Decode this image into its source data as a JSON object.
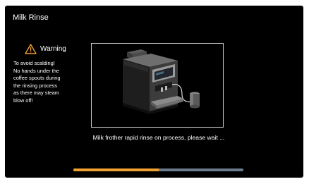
{
  "screen": {
    "title": "Milk Rinse"
  },
  "warning": {
    "label": "Warning",
    "icon": "warning-triangle-icon",
    "icon_color": "#f0a030",
    "lines": [
      "To avoid scalding!",
      "No hands under the",
      "coffee spouts during",
      "the rinsing process",
      "as there may steam",
      "blow off!"
    ]
  },
  "illustration": {
    "icon": "coffee-machine-with-milk-container"
  },
  "status": {
    "message": "Milk frother rapid rinse on process, please wait ..."
  },
  "progress": {
    "fraction": 0.5,
    "fill_color": "#f0a030",
    "track_color": "#6b7c8e"
  }
}
